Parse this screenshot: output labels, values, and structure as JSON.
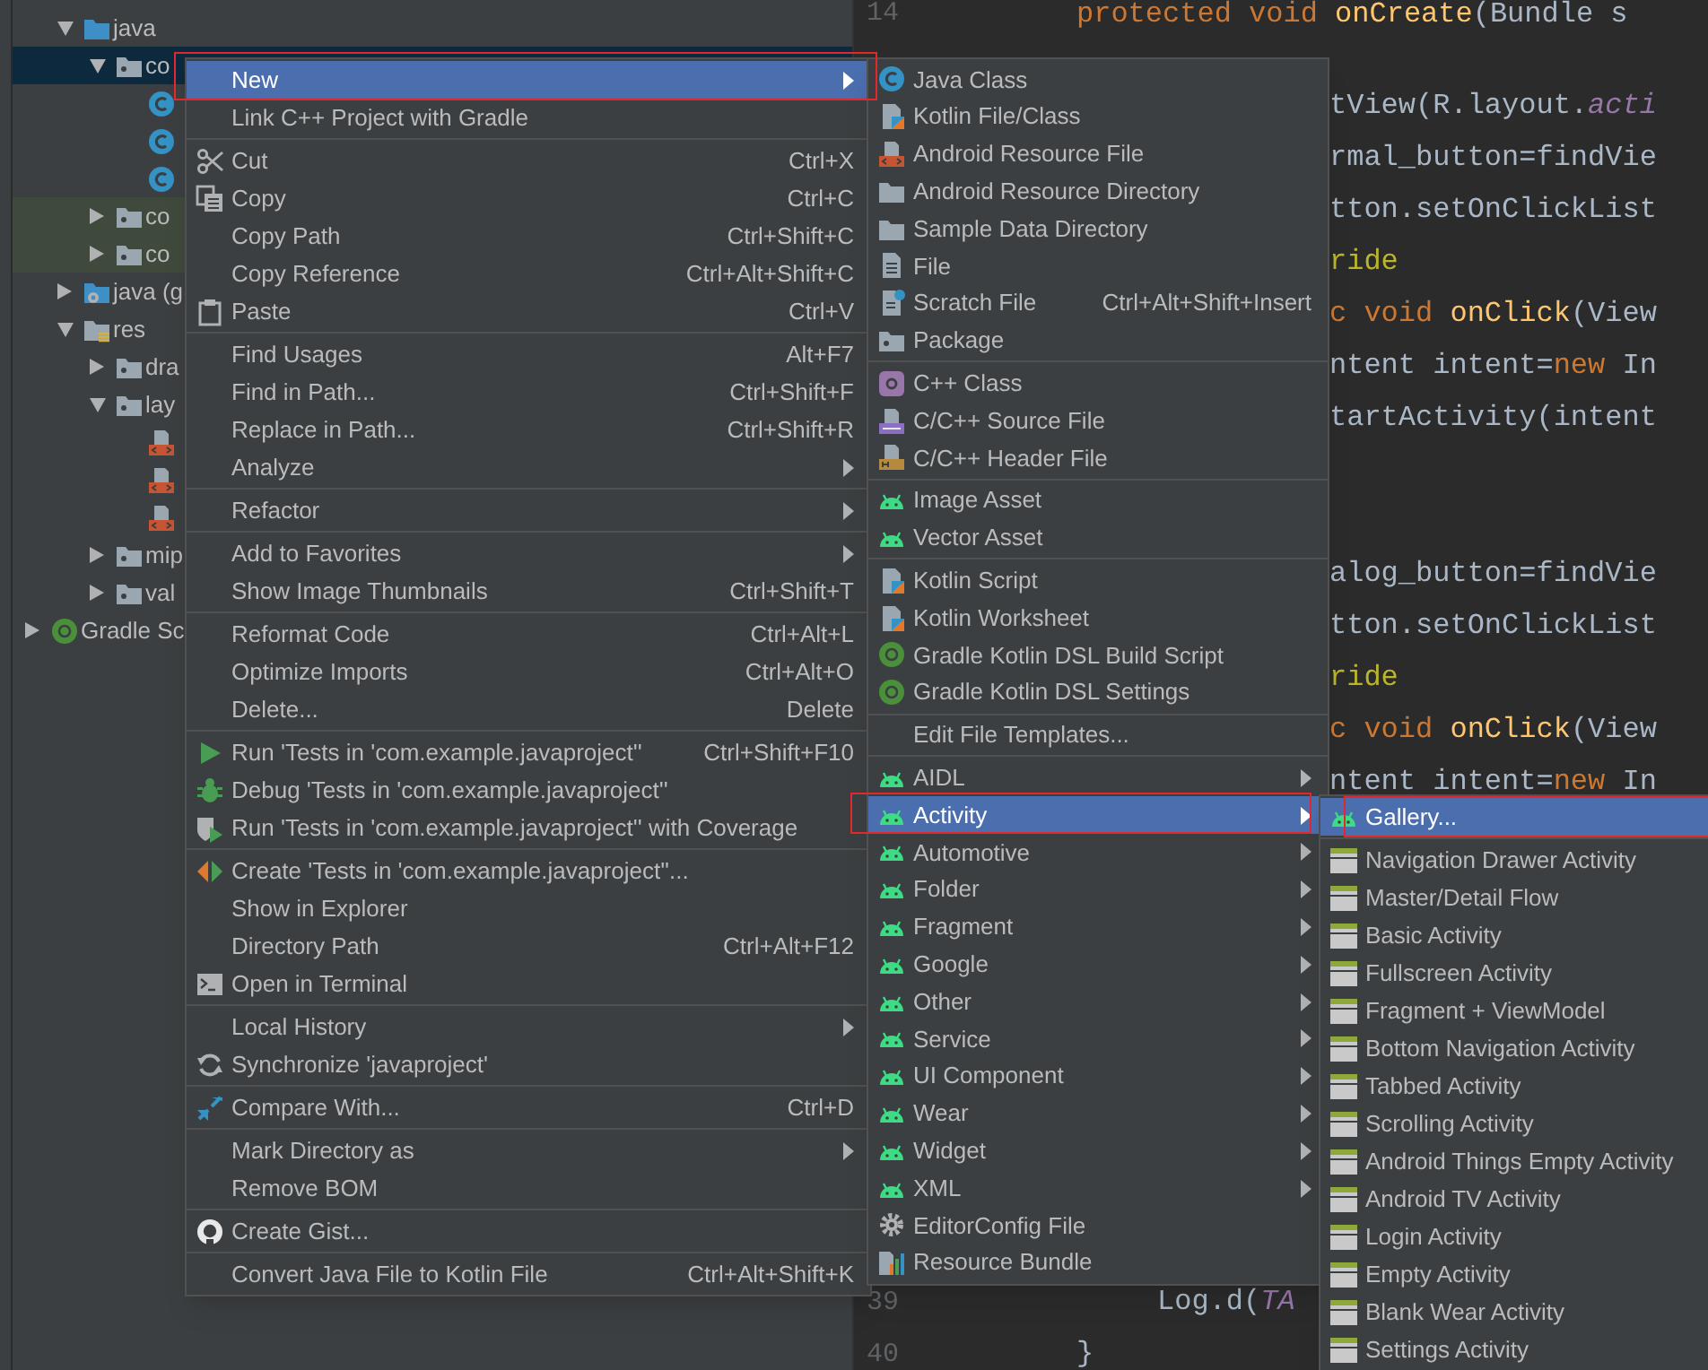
{
  "tree": {
    "items": [
      {
        "label": "java",
        "kind": "source-folder",
        "expanded": true,
        "selected": false,
        "children": [
          {
            "label": "co",
            "kind": "package",
            "expanded": true,
            "selected": true,
            "children": [
              {
                "kind": "class",
                "selected": false
              },
              {
                "kind": "class",
                "selected": false
              },
              {
                "kind": "class",
                "selected": false
              }
            ]
          },
          {
            "label": "co",
            "kind": "test-package",
            "expanded": false,
            "selected": false
          },
          {
            "label": "co",
            "kind": "test-package",
            "expanded": false,
            "selected": false
          }
        ]
      },
      {
        "label": "java (g",
        "kind": "generated-folder",
        "expanded": false,
        "selected": false
      },
      {
        "label": "res",
        "kind": "resource-folder",
        "expanded": true,
        "selected": false,
        "children": [
          {
            "label": "dra",
            "kind": "package",
            "expanded": false,
            "selected": false
          },
          {
            "label": "lay",
            "kind": "package",
            "expanded": true,
            "selected": false,
            "children": [
              {
                "kind": "layout-file",
                "selected": false
              },
              {
                "kind": "layout-file",
                "selected": false
              },
              {
                "kind": "layout-file",
                "selected": false
              }
            ]
          },
          {
            "label": "mip",
            "kind": "package",
            "expanded": false,
            "selected": false
          },
          {
            "label": "val",
            "kind": "package",
            "expanded": false,
            "selected": false
          }
        ]
      }
    ],
    "root_items": [
      {
        "label": "Gradle Sc",
        "kind": "gradle",
        "expanded": false,
        "selected": false
      }
    ]
  },
  "editor": {
    "lines": [
      {
        "number": "14",
        "kind": "outer",
        "segments": [
          {
            "kind": "keyword",
            "text": "protected void "
          },
          {
            "kind": "method",
            "text": "onCreate"
          },
          {
            "kind": "plain",
            "text": "(Bundle s"
          }
        ]
      },
      {
        "kind": "hidden"
      },
      {
        "kind": "tail",
        "segments": [
          {
            "kind": "plain",
            "text": "tView(R.layout."
          },
          {
            "kind": "field",
            "text": "acti"
          }
        ]
      },
      {
        "kind": "tail",
        "segments": [
          {
            "kind": "plain",
            "text": "rmal_button=findVie"
          }
        ]
      },
      {
        "kind": "tail",
        "segments": [
          {
            "kind": "plain",
            "text": "tton.setOnClickList"
          }
        ]
      },
      {
        "kind": "tail",
        "segments": [
          {
            "kind": "annotation",
            "text": "ride"
          }
        ]
      },
      {
        "kind": "tail",
        "segments": [
          {
            "kind": "keyword",
            "text": "c void "
          },
          {
            "kind": "method",
            "text": "onClick"
          },
          {
            "kind": "plain",
            "text": "(View"
          }
        ]
      },
      {
        "kind": "tail",
        "segments": [
          {
            "kind": "plain",
            "text": "ntent intent="
          },
          {
            "kind": "keyword",
            "text": "new"
          },
          {
            "kind": "plain",
            "text": " In"
          }
        ]
      },
      {
        "kind": "tail",
        "segments": [
          {
            "kind": "plain",
            "text": "tartActivity(intent"
          }
        ]
      },
      {
        "kind": "hidden"
      },
      {
        "kind": "hidden"
      },
      {
        "kind": "tail",
        "segments": [
          {
            "kind": "plain",
            "text": "alog_button=findVie"
          }
        ]
      },
      {
        "kind": "tail",
        "segments": [
          {
            "kind": "plain",
            "text": "tton.setOnClickList"
          }
        ]
      },
      {
        "kind": "tail",
        "segments": [
          {
            "kind": "annotation",
            "text": "ride"
          }
        ]
      },
      {
        "kind": "tail",
        "segments": [
          {
            "kind": "keyword",
            "text": "c void "
          },
          {
            "kind": "method",
            "text": "onClick"
          },
          {
            "kind": "plain",
            "text": "(View"
          }
        ]
      },
      {
        "kind": "tail",
        "segments": [
          {
            "kind": "plain",
            "text": "ntent intent="
          },
          {
            "kind": "keyword",
            "text": "new"
          },
          {
            "kind": "plain",
            "text": " In"
          }
        ]
      },
      {
        "kind": "hidden"
      },
      {
        "kind": "hidden"
      },
      {
        "kind": "hidden"
      },
      {
        "kind": "hidden"
      },
      {
        "kind": "hidden"
      },
      {
        "kind": "hidden"
      },
      {
        "kind": "hidden"
      },
      {
        "kind": "hidden"
      },
      {
        "kind": "hidden"
      },
      {
        "number": "39",
        "kind": "inner",
        "segments": [
          {
            "kind": "plain",
            "text": "Log.d("
          },
          {
            "kind": "field",
            "text": "TA"
          }
        ]
      },
      {
        "number": "40",
        "kind": "outer",
        "segments": [
          {
            "kind": "plain",
            "text": "}"
          }
        ]
      }
    ]
  },
  "context_menu": {
    "sections": [
      [
        {
          "label": "New",
          "kind": "plain",
          "submenu": true,
          "selected": true
        },
        {
          "label": "Link C++ Project with Gradle",
          "kind": "plain",
          "submenu": false,
          "selected": false
        }
      ],
      [
        {
          "label": "Cut",
          "shortcut": "Ctrl+X",
          "kind": "scissors",
          "submenu": false,
          "selected": false
        },
        {
          "label": "Copy",
          "shortcut": "Ctrl+C",
          "kind": "copy",
          "submenu": false,
          "selected": false
        },
        {
          "label": "Copy Path",
          "shortcut": "Ctrl+Shift+C",
          "kind": "plain",
          "submenu": false,
          "selected": false
        },
        {
          "label": "Copy Reference",
          "shortcut": "Ctrl+Alt+Shift+C",
          "kind": "plain",
          "submenu": false,
          "selected": false
        },
        {
          "label": "Paste",
          "shortcut": "Ctrl+V",
          "kind": "paste",
          "submenu": false,
          "selected": false
        }
      ],
      [
        {
          "label": "Find Usages",
          "shortcut": "Alt+F7",
          "kind": "plain",
          "submenu": false,
          "selected": false
        },
        {
          "label": "Find in Path...",
          "shortcut": "Ctrl+Shift+F",
          "kind": "plain",
          "submenu": false,
          "selected": false
        },
        {
          "label": "Replace in Path...",
          "shortcut": "Ctrl+Shift+R",
          "kind": "plain",
          "submenu": false,
          "selected": false
        },
        {
          "label": "Analyze",
          "kind": "plain",
          "submenu": true,
          "selected": false
        }
      ],
      [
        {
          "label": "Refactor",
          "kind": "plain",
          "submenu": true,
          "selected": false
        }
      ],
      [
        {
          "label": "Add to Favorites",
          "kind": "plain",
          "submenu": true,
          "selected": false
        },
        {
          "label": "Show Image Thumbnails",
          "shortcut": "Ctrl+Shift+T",
          "kind": "plain",
          "submenu": false,
          "selected": false
        }
      ],
      [
        {
          "label": "Reformat Code",
          "shortcut": "Ctrl+Alt+L",
          "kind": "plain",
          "submenu": false,
          "selected": false
        },
        {
          "label": "Optimize Imports",
          "shortcut": "Ctrl+Alt+O",
          "kind": "plain",
          "submenu": false,
          "selected": false
        },
        {
          "label": "Delete...",
          "shortcut": "Delete",
          "kind": "plain",
          "submenu": false,
          "selected": false
        }
      ],
      [
        {
          "label": "Run 'Tests in 'com.example.javaproject''",
          "shortcut": "Ctrl+Shift+F10",
          "kind": "run",
          "submenu": false,
          "selected": false
        },
        {
          "label": "Debug 'Tests in 'com.example.javaproject''",
          "kind": "debug",
          "submenu": false,
          "selected": false
        },
        {
          "label": "Run 'Tests in 'com.example.javaproject'' with Coverage",
          "kind": "coverage",
          "submenu": false,
          "selected": false
        }
      ],
      [
        {
          "label": "Create 'Tests in 'com.example.javaproject''...",
          "kind": "create-test",
          "submenu": false,
          "selected": false
        },
        {
          "label": "Show in Explorer",
          "kind": "plain",
          "submenu": false,
          "selected": false
        },
        {
          "label": "Directory Path",
          "shortcut": "Ctrl+Alt+F12",
          "kind": "plain",
          "submenu": false,
          "selected": false
        },
        {
          "label": "Open in Terminal",
          "kind": "terminal",
          "submenu": false,
          "selected": false
        }
      ],
      [
        {
          "label": "Local History",
          "kind": "plain",
          "submenu": true,
          "selected": false
        },
        {
          "label": "Synchronize 'javaproject'",
          "kind": "sync",
          "submenu": false,
          "selected": false
        }
      ],
      [
        {
          "label": "Compare With...",
          "shortcut": "Ctrl+D",
          "kind": "compare",
          "submenu": false,
          "selected": false
        }
      ],
      [
        {
          "label": "Mark Directory as",
          "kind": "plain",
          "submenu": true,
          "selected": false
        },
        {
          "label": "Remove BOM",
          "kind": "plain",
          "submenu": false,
          "selected": false
        }
      ],
      [
        {
          "label": "Create Gist...",
          "kind": "github",
          "submenu": false,
          "selected": false
        }
      ],
      [
        {
          "label": "Convert Java File to Kotlin File",
          "shortcut": "Ctrl+Alt+Shift+K",
          "kind": "plain",
          "submenu": false,
          "selected": false
        }
      ]
    ]
  },
  "new_submenu": {
    "sections": [
      [
        {
          "label": "Java Class",
          "kind": "class",
          "submenu": false,
          "selected": false
        },
        {
          "label": "Kotlin File/Class",
          "kind": "kotlin",
          "submenu": false,
          "selected": false
        },
        {
          "label": "Android Resource File",
          "kind": "resource-file",
          "submenu": false,
          "selected": false
        },
        {
          "label": "Android Resource Directory",
          "kind": "folder",
          "submenu": false,
          "selected": false
        },
        {
          "label": "Sample Data Directory",
          "kind": "folder",
          "submenu": false,
          "selected": false
        },
        {
          "label": "File",
          "kind": "file",
          "submenu": false,
          "selected": false
        },
        {
          "label": "Scratch File",
          "shortcut": "Ctrl+Alt+Shift+Insert",
          "kind": "scratch",
          "submenu": false,
          "selected": false
        },
        {
          "label": "Package",
          "kind": "package",
          "submenu": false,
          "selected": false
        }
      ],
      [
        {
          "label": "C++ Class",
          "kind": "cpp-class",
          "submenu": false,
          "selected": false
        },
        {
          "label": "C/C++ Source File",
          "kind": "cpp-source",
          "submenu": false,
          "selected": false
        },
        {
          "label": "C/C++ Header File",
          "kind": "cpp-header",
          "submenu": false,
          "selected": false
        }
      ],
      [
        {
          "label": "Image Asset",
          "kind": "android",
          "submenu": false,
          "selected": false
        },
        {
          "label": "Vector Asset",
          "kind": "android",
          "submenu": false,
          "selected": false
        }
      ],
      [
        {
          "label": "Kotlin Script",
          "kind": "kotlin",
          "submenu": false,
          "selected": false
        },
        {
          "label": "Kotlin Worksheet",
          "kind": "kotlin",
          "submenu": false,
          "selected": false
        },
        {
          "label": "Gradle Kotlin DSL Build Script",
          "kind": "gradle",
          "submenu": false,
          "selected": false
        },
        {
          "label": "Gradle Kotlin DSL Settings",
          "kind": "gradle",
          "submenu": false,
          "selected": false
        }
      ],
      [
        {
          "label": "Edit File Templates...",
          "kind": "plain",
          "submenu": false,
          "selected": false
        }
      ],
      [
        {
          "label": "AIDL",
          "kind": "android",
          "submenu": true,
          "selected": false
        },
        {
          "label": "Activity",
          "kind": "android",
          "submenu": true,
          "selected": true
        },
        {
          "label": "Automotive",
          "kind": "android",
          "submenu": true,
          "selected": false
        },
        {
          "label": "Folder",
          "kind": "android",
          "submenu": true,
          "selected": false
        },
        {
          "label": "Fragment",
          "kind": "android",
          "submenu": true,
          "selected": false
        },
        {
          "label": "Google",
          "kind": "android",
          "submenu": true,
          "selected": false
        },
        {
          "label": "Other",
          "kind": "android",
          "submenu": true,
          "selected": false
        },
        {
          "label": "Service",
          "kind": "android",
          "submenu": true,
          "selected": false
        },
        {
          "label": "UI Component",
          "kind": "android",
          "submenu": true,
          "selected": false
        },
        {
          "label": "Wear",
          "kind": "android",
          "submenu": true,
          "selected": false
        },
        {
          "label": "Widget",
          "kind": "android",
          "submenu": true,
          "selected": false
        },
        {
          "label": "XML",
          "kind": "android",
          "submenu": true,
          "selected": false
        },
        {
          "label": "EditorConfig File",
          "kind": "gear",
          "submenu": false,
          "selected": false
        },
        {
          "label": "Resource Bundle",
          "kind": "bundle",
          "submenu": false,
          "selected": false
        }
      ]
    ]
  },
  "activity_submenu": {
    "sections": [
      [
        {
          "label": "Gallery...",
          "kind": "android",
          "selected": true
        }
      ],
      [
        {
          "label": "Navigation Drawer Activity",
          "kind": "layout",
          "selected": false
        },
        {
          "label": "Master/Detail Flow",
          "kind": "layout",
          "selected": false
        },
        {
          "label": "Basic Activity",
          "kind": "layout",
          "selected": false
        },
        {
          "label": "Fullscreen Activity",
          "kind": "layout",
          "selected": false
        },
        {
          "label": "Fragment + ViewModel",
          "kind": "layout",
          "selected": false
        },
        {
          "label": "Bottom Navigation Activity",
          "kind": "layout",
          "selected": false
        },
        {
          "label": "Tabbed Activity",
          "kind": "layout",
          "selected": false
        },
        {
          "label": "Scrolling Activity",
          "kind": "layout",
          "selected": false
        },
        {
          "label": "Android Things Empty Activity",
          "kind": "layout",
          "selected": false
        },
        {
          "label": "Android TV Activity",
          "kind": "layout",
          "selected": false
        },
        {
          "label": "Login Activity",
          "kind": "layout",
          "selected": false
        },
        {
          "label": "Empty Activity",
          "kind": "layout",
          "selected": false
        },
        {
          "label": "Blank Wear Activity",
          "kind": "layout",
          "selected": false
        },
        {
          "label": "Settings Activity",
          "kind": "layout",
          "selected": false
        }
      ]
    ]
  }
}
